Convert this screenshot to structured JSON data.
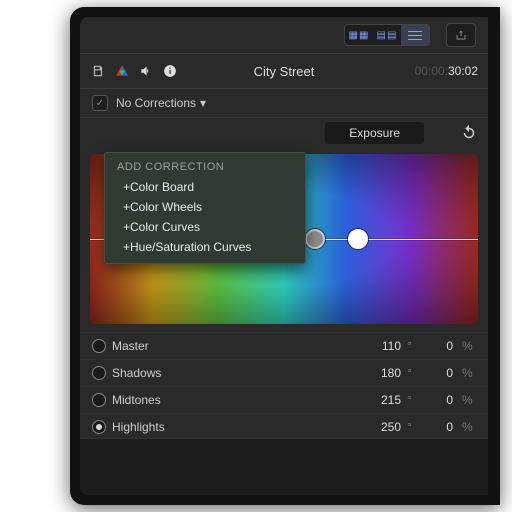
{
  "header": {
    "title": "City Street",
    "timecode_elapsed": "00:00:",
    "timecode_current": "30:02"
  },
  "subheader": {
    "correction_name": "No Corrections",
    "chevron": "▾"
  },
  "popover": {
    "title": "ADD CORRECTION",
    "items": [
      "+Color Board",
      "+Color Wheels",
      "+Color Curves",
      "+Hue/Saturation Curves"
    ]
  },
  "tabs": {
    "exposure": "Exposure"
  },
  "params": [
    {
      "label": "Master",
      "angle": 110,
      "percent": 0,
      "selected": false
    },
    {
      "label": "Shadows",
      "angle": 180,
      "percent": 0,
      "selected": false
    },
    {
      "label": "Midtones",
      "angle": 215,
      "percent": 0,
      "selected": false
    },
    {
      "label": "Highlights",
      "angle": 250,
      "percent": 0,
      "selected": true
    }
  ],
  "units": {
    "deg": "°",
    "pct": "%"
  },
  "seg": {
    "a": "▦▦",
    "b": "▤▤"
  }
}
